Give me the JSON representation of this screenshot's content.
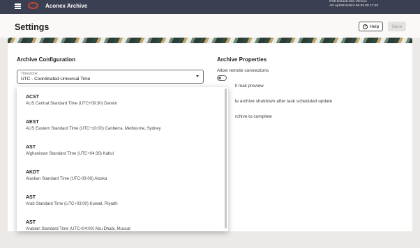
{
  "app": {
    "title": "Aconex Archive",
    "env_line1": "EXE.Default-Site-Version",
    "env_line2": "AP-ap1951045/4-08-05.08.17:48"
  },
  "header": {
    "page_title": "Settings",
    "help_label": "Help",
    "save_label": "Save"
  },
  "archive_configuration": {
    "title": "Archive Configuration",
    "timezone": {
      "label": "Timezone",
      "value": "UTC - Coordinated Universal Time"
    }
  },
  "archive_properties": {
    "title": "Archive Properties",
    "allow_remote_label": "Allow remote connections",
    "item2": "ll mail preview",
    "item3": "le archive shutdown after task scheduled update",
    "item4": "rchive to complete"
  },
  "timezone_options": [
    {
      "abbr": "ACST",
      "name": "AUS Central Standard Time",
      "offset": "(UTC+09:30) Darwin"
    },
    {
      "abbr": "AEST",
      "name": "AUS Eastern Standard Time",
      "offset": "(UTC+10:00) Canberra, Melbourne, Sydney"
    },
    {
      "abbr": "AST",
      "name": "Afghanistan Standard Time",
      "offset": "(UTC+04:30) Kabul"
    },
    {
      "abbr": "AKDT",
      "name": "Alaskan Standard Time",
      "offset": "(UTC-09:00) Alaska"
    },
    {
      "abbr": "AST",
      "name": "Arab Standard Time",
      "offset": "(UTC+03:00) Kuwait, Riyadh"
    },
    {
      "abbr": "AST",
      "name": "Arabian Standard Time",
      "offset": "(UTC+04:00) Abu Dhabi, Muscat"
    }
  ],
  "colors": {
    "topbar": "#3a3f51",
    "brand_red": "#c74634",
    "page_bg": "#ece9e6"
  }
}
